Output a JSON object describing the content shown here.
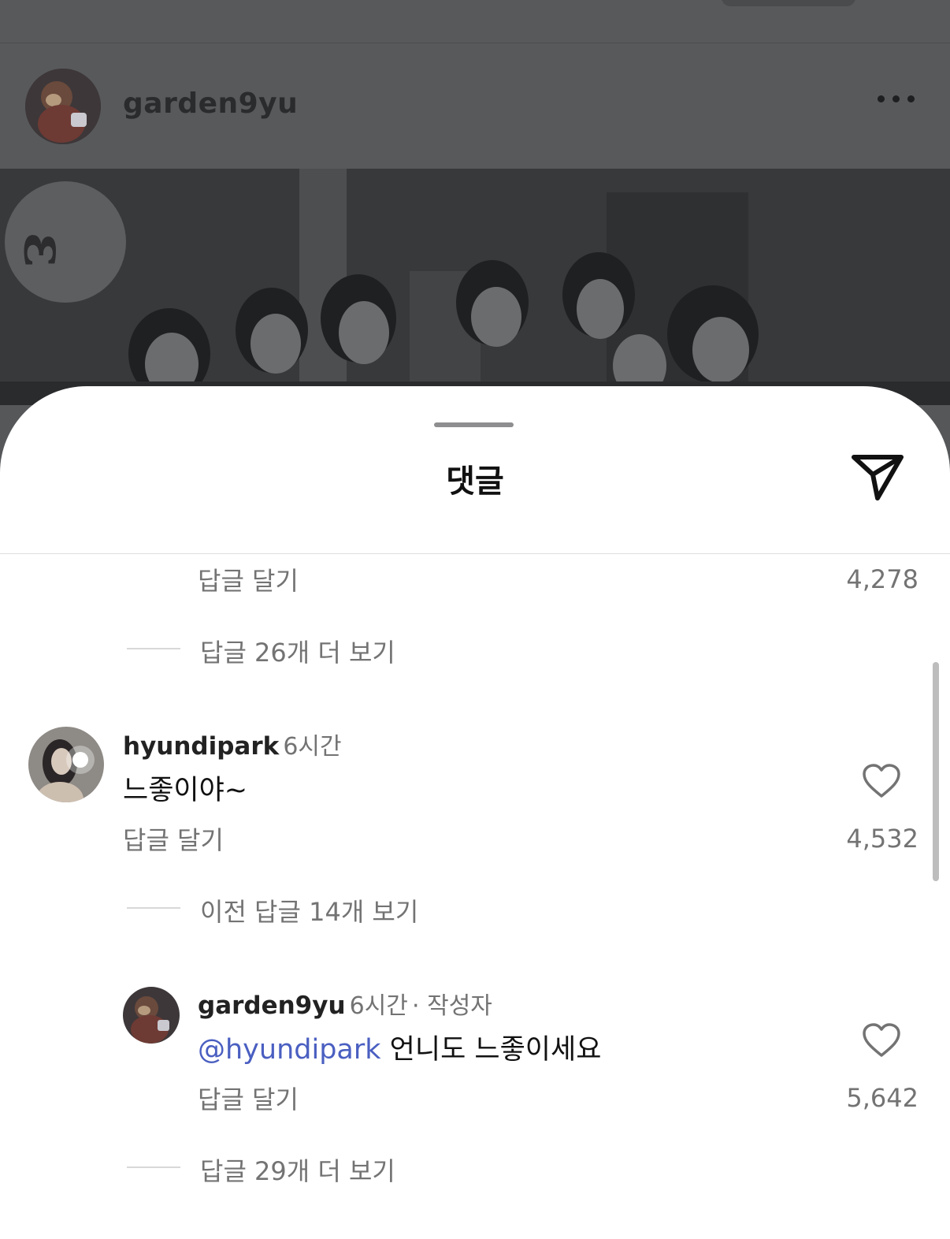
{
  "post": {
    "username": "garden9yu"
  },
  "sheet": {
    "title": "댓글"
  },
  "comments_top": {
    "reply_label": "답글 달기",
    "like_count": "4,278",
    "view_more": "답글 26개 더 보기"
  },
  "comment1": {
    "username": "hyundipark",
    "time": "6시간",
    "text": "느좋이야~",
    "reply_label": "답글 달기",
    "like_count": "4,532",
    "view_previous": "이전 답글 14개 보기"
  },
  "reply1": {
    "username": "garden9yu",
    "time": "6시간",
    "author_tag": "· 작성자",
    "mention": "@hyundipark",
    "text": "언니도 느좋이세요",
    "reply_label": "답글 달기",
    "like_count": "5,642",
    "view_more": "답글 29개 더 보기"
  },
  "icons": {
    "more": "more-horizontal-icon",
    "share": "send-icon",
    "like": "heart-outline-icon"
  },
  "colors": {
    "mention": "#4a5fc1",
    "secondary_text": "#737373",
    "overlay_background": "#58595b"
  }
}
